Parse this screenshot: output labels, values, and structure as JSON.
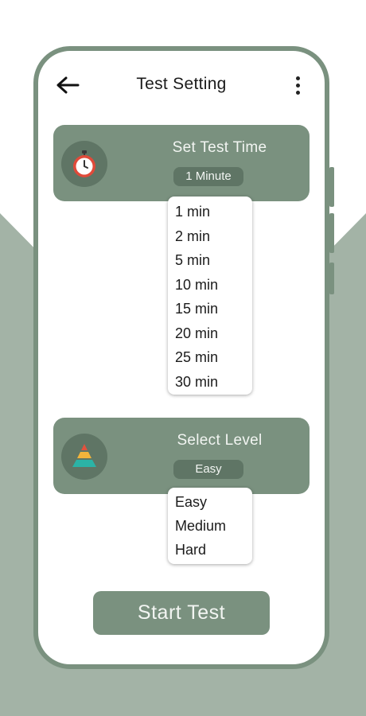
{
  "header": {
    "title": "Test Setting",
    "back_icon": "arrow-left-icon",
    "menu_icon": "more-vertical-icon"
  },
  "time_card": {
    "label": "Set Test Time",
    "selected": "1 Minute",
    "icon": "stopwatch-icon",
    "options": [
      "1 min",
      "2 min",
      "5 min",
      "10 min",
      "15 min",
      "20 min",
      "25 min",
      "30 min"
    ]
  },
  "level_card": {
    "label": "Select Level",
    "selected": "Easy",
    "icon": "pyramid-icon",
    "options": [
      "Easy",
      "Medium",
      "Hard"
    ]
  },
  "start_button": {
    "label": "Start Test"
  },
  "colors": {
    "accent": "#7a917f",
    "accent_dark": "#5f7565",
    "background_shape": "#a3b3a6",
    "icon_red": "#e04a3a",
    "pyramid_red": "#e2523e",
    "pyramid_yellow": "#f2b43b",
    "pyramid_teal": "#2bb3a6"
  }
}
